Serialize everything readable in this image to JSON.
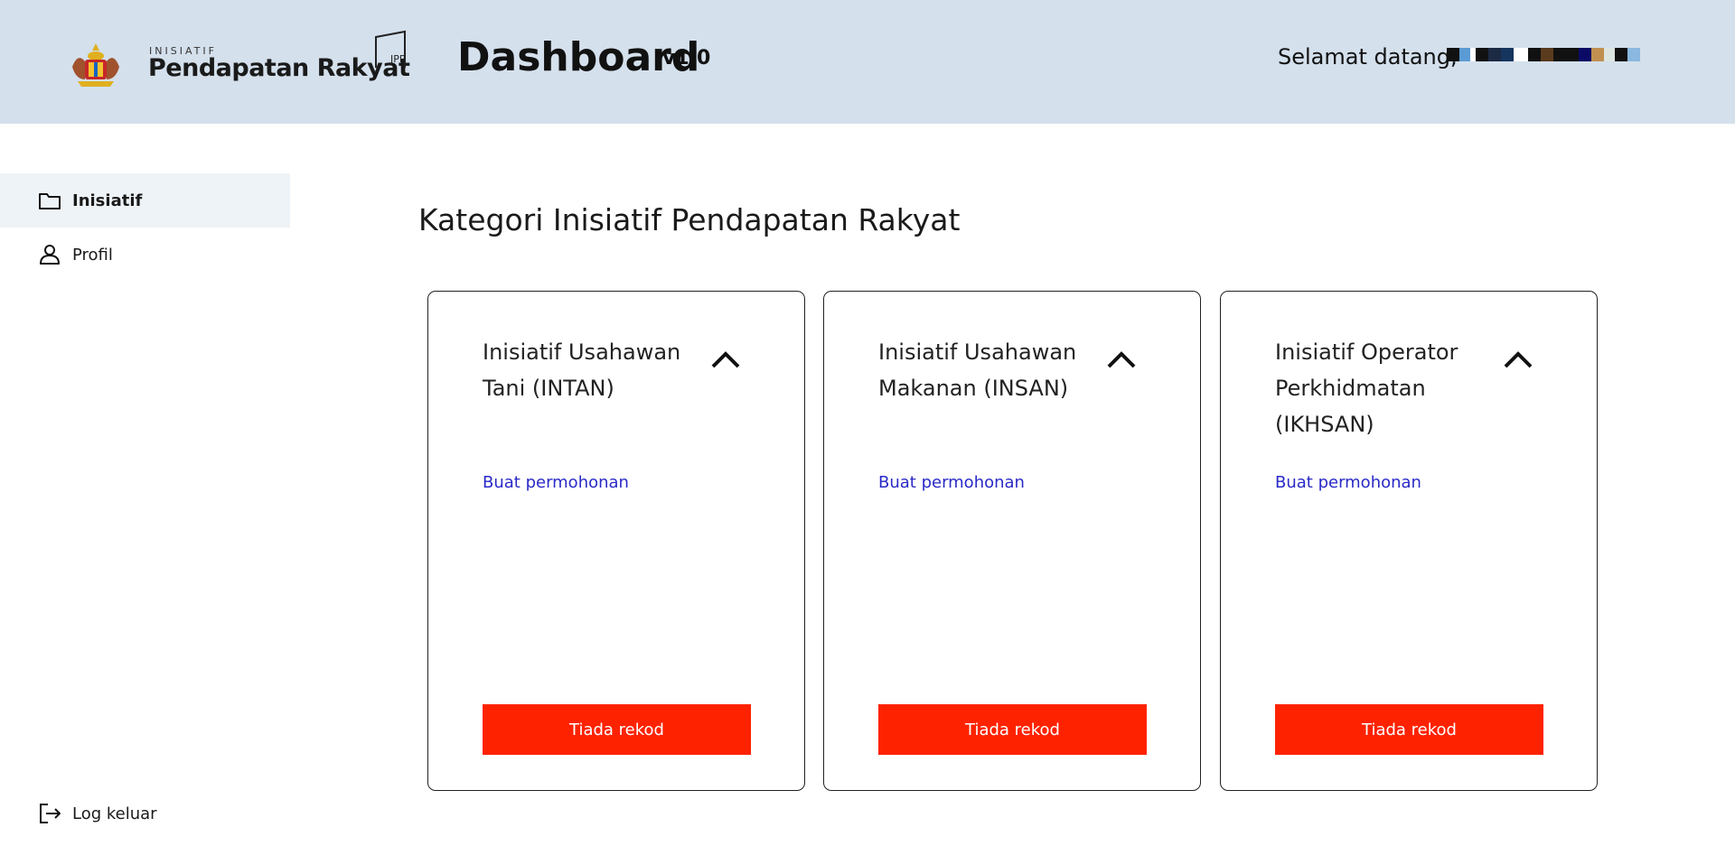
{
  "header": {
    "brand_small": "INISIATIF",
    "brand_big": "Pendapatan Rakyat",
    "jpr_logo_text": "JPR",
    "title": "Dashboard",
    "version": "v1.0",
    "welcome": "Selamat datang,"
  },
  "colors": {
    "header_bg": "#d4e0ec",
    "sidebar_active_bg": "#eef3f7",
    "link": "#2a2ac8",
    "button_bg": "#ff2200"
  },
  "sidebar": {
    "items": [
      {
        "label": "Inisiatif",
        "icon": "folder-icon",
        "active": true
      },
      {
        "label": "Profil",
        "icon": "user-icon",
        "active": false
      }
    ],
    "logout": {
      "label": "Log keluar",
      "icon": "logout-icon"
    }
  },
  "main": {
    "heading": "Kategori Inisiatif Pendapatan Rakyat",
    "cards": [
      {
        "title": "Inisiatif Usahawan Tani (INTAN)",
        "link": "Buat permohonan",
        "button": "Tiada rekod",
        "icon": "chevron-up-icon"
      },
      {
        "title": "Inisiatif Usahawan Makanan (INSAN)",
        "link": "Buat permohonan",
        "button": "Tiada rekod",
        "icon": "chevron-up-icon"
      },
      {
        "title": "Inisiatif Operator Perkhidmatan (IKHSAN)",
        "link": "Buat permohonan",
        "button": "Tiada rekod",
        "icon": "chevron-up-icon"
      }
    ]
  }
}
